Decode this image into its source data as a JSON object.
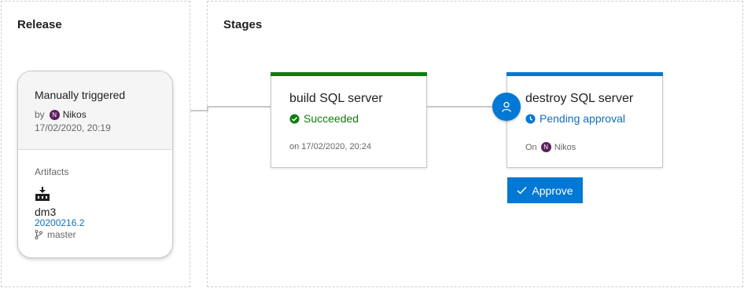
{
  "release_panel": {
    "title": "Release"
  },
  "stages_panel": {
    "title": "Stages"
  },
  "release_card": {
    "trigger": "Manually triggered",
    "by_label": "by",
    "user_initial": "N",
    "user_name": "Nikos",
    "date": "17/02/2020, 20:19",
    "artifacts_label": "Artifacts",
    "artifact": {
      "icon": "build-artifact-icon",
      "name": "dm3",
      "version": "20200216.2",
      "branch": "master"
    }
  },
  "stages": [
    {
      "name": "build SQL server",
      "status": "Succeeded",
      "status_icon": "check-circle-icon",
      "meta": "on 17/02/2020, 20:24",
      "accent": "#107c10"
    },
    {
      "name": "destroy SQL server",
      "status": "Pending approval",
      "status_icon": "clock-icon",
      "meta_prefix": "On",
      "meta_user_initial": "N",
      "meta_user": "Nikos",
      "accent": "#0078d4",
      "approver_icon": "person-icon",
      "approve_label": "Approve"
    }
  ],
  "colors": {
    "success": "#107c10",
    "primary": "#0078d4",
    "avatar": "#5c1e5d",
    "link": "#106ebe"
  }
}
